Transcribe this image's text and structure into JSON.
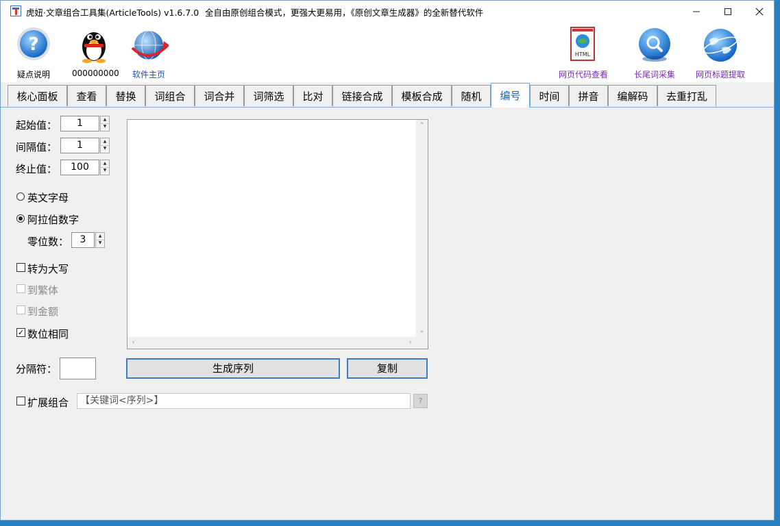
{
  "window": {
    "title": "虎妞·文章组合工具集(ArticleTools) v1.6.7.0",
    "slogan": "全自由原创组合模式，更强大更易用，《原创文章生成器》的全新替代软件"
  },
  "toolbar": {
    "help_label": "疑点说明",
    "qq_label": "000000000",
    "home_label": "软件主页",
    "html_view_label": "网页代码查看",
    "longtail_label": "长尾词采集",
    "title_extract_label": "网页标题提取",
    "html_badge": "HTML"
  },
  "tabs": [
    "核心面板",
    "查看",
    "替换",
    "词组合",
    "词合并",
    "词筛选",
    "比对",
    "链接合成",
    "模板合成",
    "随机",
    "编号",
    "时间",
    "拼音",
    "编解码",
    "去重打乱"
  ],
  "active_tab": "编号",
  "form": {
    "start_label": "起始值：",
    "start_value": "1",
    "step_label": "间隔值：",
    "step_value": "1",
    "end_label": "终止值：",
    "end_value": "100",
    "letters_label": "英文字母",
    "arabic_label": "阿拉伯数字",
    "zeros_label": "零位数：",
    "zeros_value": "3",
    "upper_label": "转为大写",
    "trad_label": "到繁体",
    "money_label": "到金额",
    "samelen_label": "数位相同",
    "sep_label": "分隔符：",
    "generate_label": "生成序列",
    "copy_label": "复制",
    "expand_label": "扩展组合",
    "expand_template": "【关键词<序列>】",
    "help_mark": "?"
  },
  "colors": {
    "accent": "#3d7cc9",
    "link_purple": "#7b28b4",
    "desktop": "#2a7fc0"
  }
}
